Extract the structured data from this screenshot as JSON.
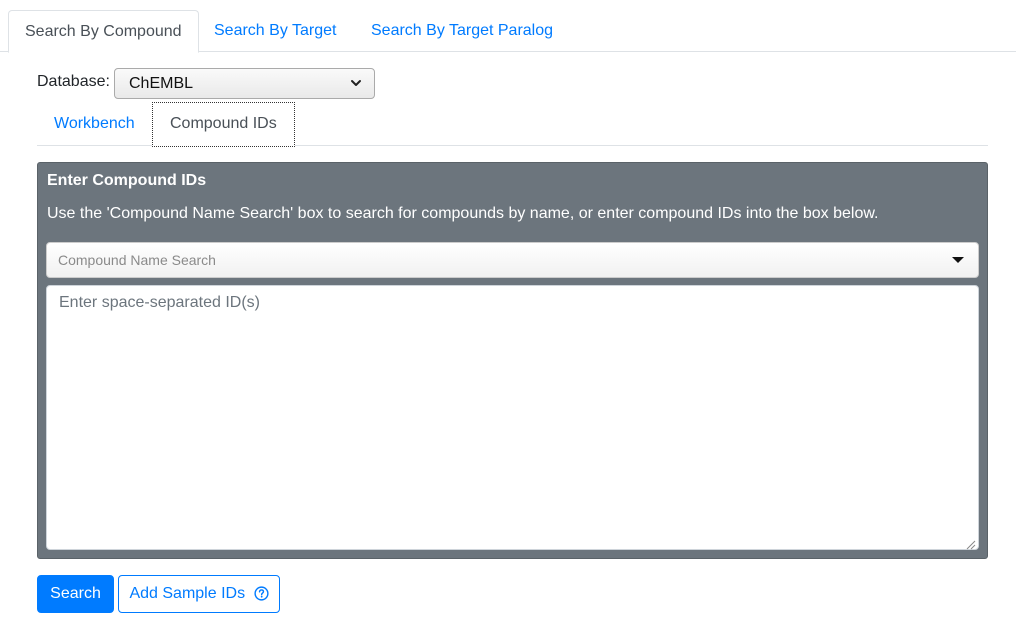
{
  "top_tabs": [
    {
      "label": "Search By Compound",
      "active": true
    },
    {
      "label": "Search By Target",
      "active": false
    },
    {
      "label": "Search By Target Paralog",
      "active": false
    }
  ],
  "database": {
    "label": "Database:",
    "selected": "ChEMBL"
  },
  "sub_tabs": [
    {
      "label": "Workbench",
      "active": false
    },
    {
      "label": "Compound IDs",
      "active": true
    }
  ],
  "panel": {
    "title": "Enter Compound IDs",
    "description": "Use the 'Compound Name Search' box to search for compounds by name, or enter compound IDs into the box below.",
    "name_search_placeholder": "Compound Name Search",
    "ids_placeholder": "Enter space-separated ID(s)",
    "ids_value": ""
  },
  "buttons": {
    "search": "Search",
    "add_sample": "Add Sample IDs"
  },
  "colors": {
    "primary": "#007bff",
    "panel_bg": "#6c757d",
    "tab_inactive_text": "#007bff",
    "tab_active_text": "#495057"
  },
  "icons": {
    "select_chevron": "chevron-down-icon",
    "name_search_caret": "caret-down-icon",
    "sample_help": "question-circle-icon",
    "textarea_resize": "resize-handle-icon"
  }
}
